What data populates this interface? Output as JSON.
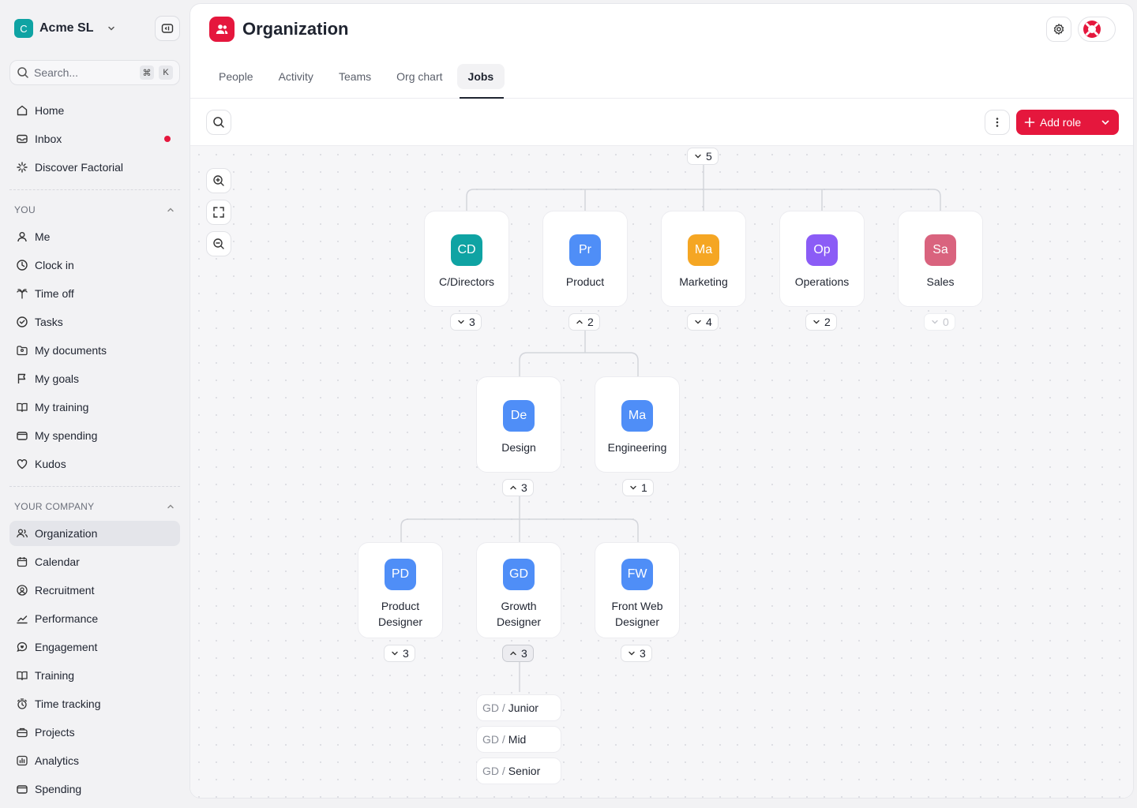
{
  "company": {
    "initial": "C",
    "name": "Acme SL"
  },
  "search": {
    "placeholder": "Search...",
    "shortcut_mod": "⌘",
    "shortcut_key": "K"
  },
  "nav_top": [
    {
      "label": "Home",
      "icon": "home-icon"
    },
    {
      "label": "Inbox",
      "icon": "inbox-icon",
      "badge": true
    },
    {
      "label": "Discover Factorial",
      "icon": "sparkle-icon"
    }
  ],
  "section_you": "YOU",
  "nav_you": [
    {
      "label": "Me",
      "icon": "person-icon"
    },
    {
      "label": "Clock in",
      "icon": "clock-icon"
    },
    {
      "label": "Time off",
      "icon": "palm-tree-icon"
    },
    {
      "label": "Tasks",
      "icon": "check-circle-icon"
    },
    {
      "label": "My documents",
      "icon": "folder-person-icon"
    },
    {
      "label": "My goals",
      "icon": "flag-icon"
    },
    {
      "label": "My training",
      "icon": "book-icon"
    },
    {
      "label": "My spending",
      "icon": "wallet-icon"
    },
    {
      "label": "Kudos",
      "icon": "heart-icon"
    }
  ],
  "section_company": "YOUR COMPANY",
  "nav_company": [
    {
      "label": "Organization",
      "icon": "people-icon",
      "active": true
    },
    {
      "label": "Calendar",
      "icon": "calendar-icon"
    },
    {
      "label": "Recruitment",
      "icon": "recruitment-icon"
    },
    {
      "label": "Performance",
      "icon": "trend-icon"
    },
    {
      "label": "Engagement",
      "icon": "chat-heart-icon"
    },
    {
      "label": "Training",
      "icon": "book-icon"
    },
    {
      "label": "Time tracking",
      "icon": "stopwatch-icon"
    },
    {
      "label": "Projects",
      "icon": "briefcase-icon"
    },
    {
      "label": "Analytics",
      "icon": "analytics-icon"
    },
    {
      "label": "Spending",
      "icon": "wallet-icon"
    }
  ],
  "page": {
    "title": "Organization"
  },
  "tabs": [
    {
      "label": "People"
    },
    {
      "label": "Activity"
    },
    {
      "label": "Teams"
    },
    {
      "label": "Org chart"
    },
    {
      "label": "Jobs",
      "active": true
    }
  ],
  "toolbar": {
    "add_role_label": "Add role"
  },
  "colors": {
    "accent": "#e5173d",
    "teal": "#0fa3a3",
    "blue": "#4f8ef7",
    "orange": "#f5a623",
    "purple": "#8b5cf6",
    "rose": "#d9637e"
  },
  "org": {
    "root_count": "5",
    "departments": [
      {
        "initials": "CD",
        "name": "C/Directors",
        "count": "3",
        "expanded": false,
        "color": "#0fa3a3"
      },
      {
        "initials": "Pr",
        "name": "Product",
        "count": "2",
        "expanded": true,
        "color": "#4f8ef7"
      },
      {
        "initials": "Ma",
        "name": "Marketing",
        "count": "4",
        "expanded": false,
        "color": "#f5a623"
      },
      {
        "initials": "Op",
        "name": "Operations",
        "count": "2",
        "expanded": false,
        "color": "#8b5cf6"
      },
      {
        "initials": "Sa",
        "name": "Sales",
        "count": "0",
        "expanded": false,
        "color": "#d9637e"
      }
    ],
    "product_children": [
      {
        "initials": "De",
        "name": "Design",
        "count": "3",
        "expanded": true,
        "color": "#4f8ef7"
      },
      {
        "initials": "Ma",
        "name": "Engineering",
        "count": "1",
        "expanded": false,
        "color": "#4f8ef7"
      }
    ],
    "design_children": [
      {
        "initials": "PD",
        "name_line1": "Product",
        "name_line2": "Designer",
        "count": "3",
        "expanded": false,
        "color": "#4f8ef7"
      },
      {
        "initials": "GD",
        "name_line1": "Growth",
        "name_line2": "Designer",
        "count": "3",
        "expanded": true,
        "color": "#4f8ef7"
      },
      {
        "initials": "FW",
        "name_line1": "Front Web",
        "name_line2": "Designer",
        "count": "3",
        "expanded": false,
        "color": "#4f8ef7"
      }
    ],
    "levels_prefix": "GD /",
    "levels": [
      "Junior",
      "Mid",
      "Senior"
    ]
  }
}
